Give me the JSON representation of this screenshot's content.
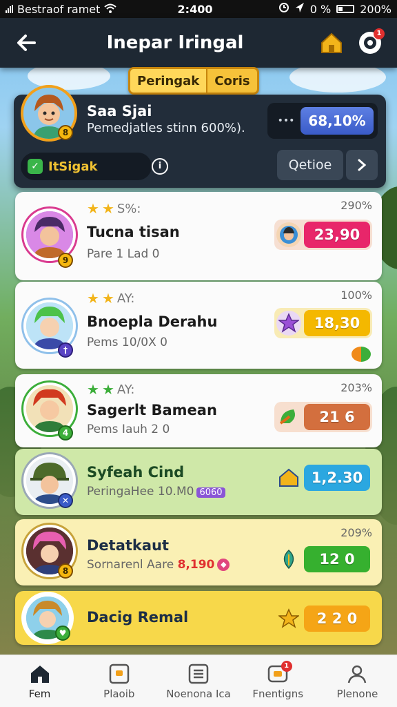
{
  "status_bar": {
    "carrier": "Bestraof ramet",
    "time": "2:400",
    "battery_text": "0 %",
    "battery_pct": "200%"
  },
  "header": {
    "title": "Inepar Iringal"
  },
  "tabs": [
    {
      "label": "Peringak"
    },
    {
      "label": "Coris"
    }
  ],
  "player": {
    "name": "Saa Sjai",
    "description": "Pemedjatles stinn 600%).",
    "level": "8",
    "score_dots": "•••",
    "score": "68,10%",
    "status": "ItSigak",
    "option_label": "Qetioe"
  },
  "entries": [
    {
      "stars": 2,
      "rank_text": "S%:",
      "percent": "290%",
      "name": "Tucna tisan",
      "sub": "Pare 1 Lad 0",
      "score": "23,90",
      "score_color": "#e8266a",
      "level": "9",
      "star_color": "gold"
    },
    {
      "stars": 2,
      "rank_text": "AY:",
      "percent": "100%",
      "name": "Bnoepla Derahu",
      "sub": "Pems 10/0X 0",
      "score": "18,30",
      "score_color": "#f4b800",
      "level": "†",
      "star_color": "gold"
    },
    {
      "stars": 2,
      "rank_text": "AY:",
      "percent": "203%",
      "name": "Sagerlt Bamean",
      "sub": "Pems Iauh 2 0",
      "score": "21 6",
      "score_color": "#d36f3e",
      "level": "4",
      "star_color": "green"
    },
    {
      "stars": 0,
      "rank_text": "",
      "percent": "",
      "name": "Syfeah Cind",
      "sub": "PeringaHee 10.M0",
      "sub_badge": "6060",
      "score": "1,2.30",
      "score_color": "#2ba7e0",
      "level": "✕"
    },
    {
      "stars": 0,
      "rank_text": "",
      "percent": "209%",
      "name": "Detatkaut",
      "sub": "Sornarenl Aare",
      "sub_value": "8,190",
      "score": "12 0",
      "score_color": "#36b02f",
      "level": "8"
    },
    {
      "stars": 0,
      "rank_text": "",
      "percent": "",
      "name": "Dacig Remal",
      "sub": "",
      "score": "2 2 0",
      "score_color": "#f5a516",
      "level": "♥"
    }
  ],
  "bottom_nav": [
    {
      "label": "Fem",
      "icon": "home-icon"
    },
    {
      "label": "Plaoib",
      "icon": "play-icon"
    },
    {
      "label": "Noenona Ica",
      "icon": "list-icon"
    },
    {
      "label": "Fnentigns",
      "icon": "messages-icon",
      "badge": "1"
    },
    {
      "label": "Plenone",
      "icon": "profile-icon"
    }
  ],
  "colors": {
    "header_bg": "#1e2833",
    "panel_bg": "#222d3a",
    "tab_bg": "#f6c23a",
    "score_blue": "#3a5bc8"
  }
}
